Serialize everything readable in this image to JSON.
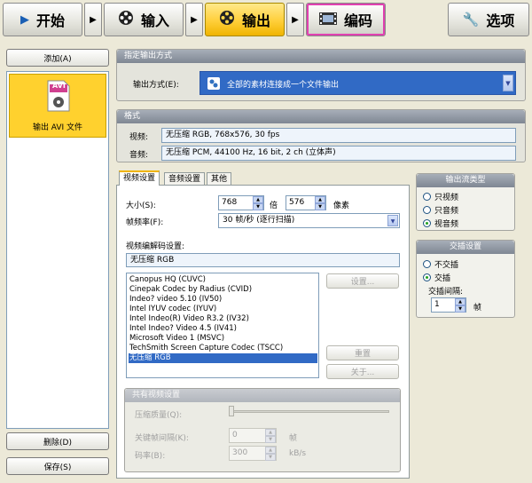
{
  "nav": {
    "start": "开始",
    "input": "输入",
    "output": "输出",
    "encode": "编码",
    "options": "选项"
  },
  "left": {
    "add_button": "添加(A)",
    "item_badge": "AVI",
    "item_label": "输出 AVI 文件",
    "delete_button": "删除(D)",
    "save_button": "保存(S)"
  },
  "output_method": {
    "title": "指定输出方式",
    "label": "输出方式(E):",
    "value": "全部的素材连接成一个文件输出"
  },
  "format": {
    "title": "格式",
    "video_label": "视频:",
    "video_value": "无压缩 RGB, 768x576, 30 fps",
    "audio_label": "音频:",
    "audio_value": "无压缩 PCM, 44100 Hz, 16 bit, 2 ch (立体声)"
  },
  "tabs": [
    "视频设置",
    "音频设置",
    "其他"
  ],
  "video": {
    "size_label": "大小(S):",
    "width": "768",
    "times_label": "倍",
    "height": "576",
    "pixels_label": "像素",
    "framerate_label": "帧频率(F):",
    "framerate_value": "30 帧/秒 (逐行扫描)",
    "codec_setting_label": "视频编解码设置:",
    "codec_current": "无压缩 RGB",
    "codecs": [
      "Canopus HQ (CUVC)",
      "Cinepak Codec by Radius (CVID)",
      "Indeo? video 5.10 (IV50)",
      "Intel IYUV codec (IYUV)",
      "Intel Indeo(R) Video R3.2 (IV32)",
      "Intel Indeo? Video 4.5 (IV41)",
      "Microsoft Video 1 (MSVC)",
      "TechSmith Screen Capture Codec (TSCC)",
      "无压缩 RGB"
    ],
    "settings_button": "设置...",
    "reset_button": "重置",
    "about_button": "关于...",
    "common_title": "共有视频设置",
    "quality_label": "压缩质量(Q):",
    "keyframe_label": "关键帧间隔(K):",
    "keyframe_value": "0",
    "keyframe_unit": "帧",
    "bitrate_label": "码率(B):",
    "bitrate_value": "300",
    "bitrate_unit": "kB/s"
  },
  "stream": {
    "title": "输出流类型",
    "video_only": "只视频",
    "audio_only": "只音频",
    "both": "视音频"
  },
  "interlace": {
    "title": "交插设置",
    "none": "不交插",
    "interlace": "交插",
    "interval_label": "交插间隔:",
    "interval_value": "1",
    "interval_unit": "帧"
  }
}
